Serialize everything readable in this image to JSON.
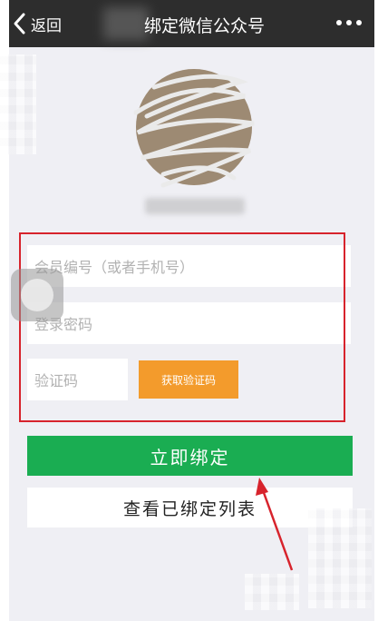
{
  "header": {
    "back_label": "返回",
    "title": "绑定微信公众号"
  },
  "form": {
    "member_placeholder": "会员编号（或者手机号）",
    "password_placeholder": "登录密码",
    "code_placeholder": "验证码",
    "get_code_label": "获取验证码"
  },
  "actions": {
    "bind_label": "立即绑定",
    "view_list_label": "查看已绑定列表"
  },
  "colors": {
    "header_bg": "#2d2d2d",
    "screen_bg": "#efeff4",
    "primary_green": "#1aad52",
    "code_orange": "#f39b2c",
    "annotation_red": "#d7232c"
  },
  "icons": [
    "back-chevron-icon",
    "more-dots-icon"
  ]
}
